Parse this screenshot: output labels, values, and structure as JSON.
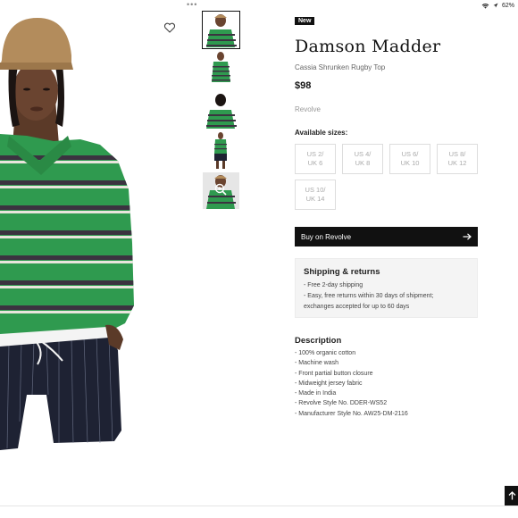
{
  "status": {
    "battery": "62%"
  },
  "product": {
    "badge": "New",
    "brand": "Damson Madder",
    "name": "Cassia Shrunken Rugby Top",
    "price": "$98",
    "seller": "Revolve"
  },
  "sizes": {
    "label": "Available sizes:",
    "options": [
      "US 2/\nUK 6",
      "US 4/\nUK 8",
      "US 6/\nUK 10",
      "US 8/\nUK 12",
      "US 10/\nUK 14"
    ]
  },
  "buy": {
    "label": "Buy on Revolve"
  },
  "shipping": {
    "title": "Shipping & returns",
    "line1": "- Free 2-day shipping",
    "line2": "- Easy, free returns within 30 days of shipment;",
    "line3": "exchanges accepted for up to 60 days"
  },
  "description": {
    "title": "Description",
    "items": [
      "- 100% organic cotton",
      "- Machine wash",
      "- Front partial button closure",
      "- Midweight jersey fabric",
      "- Made in India",
      "- Revolve Style No. DDER-WS52",
      "- Manufacturer Style No. AW25-DM-2116"
    ]
  },
  "colors": {
    "shirt_green": "#2f9a4f",
    "stripe_dark": "#3b3340",
    "shorts_navy": "#1e2233",
    "hat_tan": "#b38c5c"
  }
}
